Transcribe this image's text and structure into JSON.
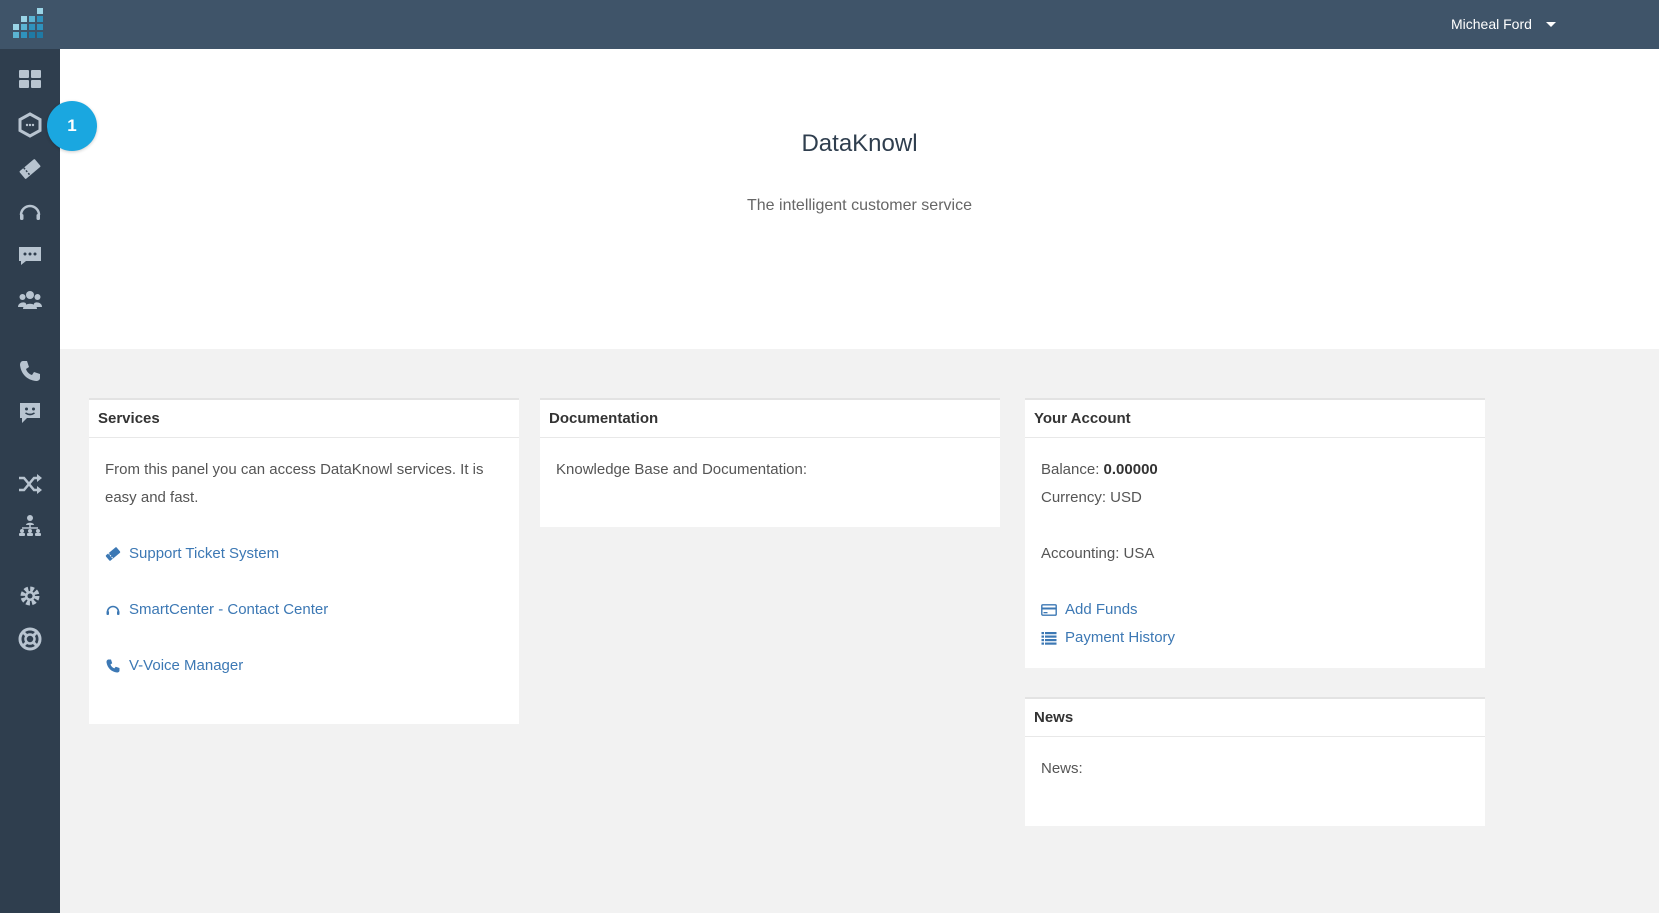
{
  "header": {
    "user_name": "Micheal Ford",
    "logo_icon": "grid-logo-icon"
  },
  "sidebar": {
    "items": [
      {
        "name": "dashboard",
        "icon": "dashboard-icon"
      },
      {
        "name": "services",
        "icon": "hexagon-icon"
      },
      {
        "name": "tickets",
        "icon": "ticket-icon"
      },
      {
        "name": "contact-center",
        "icon": "headset-icon"
      },
      {
        "name": "chat",
        "icon": "chat-icon"
      },
      {
        "name": "users",
        "icon": "users-icon"
      },
      {
        "name": "phone",
        "icon": "phone-icon"
      },
      {
        "name": "feedback",
        "icon": "feedback-icon"
      },
      {
        "name": "routing",
        "icon": "shuffle-icon"
      },
      {
        "name": "organization",
        "icon": "sitemap-icon"
      },
      {
        "name": "settings",
        "icon": "gear-icon"
      },
      {
        "name": "help",
        "icon": "lifebuoy-icon"
      }
    ],
    "badge": "1"
  },
  "hero": {
    "title": "DataKnowl",
    "subtitle": "The intelligent customer service"
  },
  "services": {
    "title": "Services",
    "description": "From this panel you can access DataKnowl services. It is easy and fast.",
    "links": [
      {
        "label": "Support Ticket System",
        "icon": "ticket-icon"
      },
      {
        "label": "SmartCenter - Contact Center",
        "icon": "headset-icon"
      },
      {
        "label": "V-Voice Manager",
        "icon": "phone-icon"
      }
    ]
  },
  "documentation": {
    "title": "Documentation",
    "text": "Knowledge Base and Documentation:"
  },
  "account": {
    "title": "Your Account",
    "balance_label": "Balance:",
    "balance_value": "0.00000",
    "currency": "Currency: USD",
    "accounting": "Accounting: USA",
    "add_funds": "Add Funds",
    "payment_history": "Payment History"
  },
  "news": {
    "title": "News",
    "text": "News:"
  },
  "colors": {
    "topbar": "#3f5469",
    "sidebar": "#2f3e4e",
    "accent": "#1aa7e0",
    "link": "#3c78b4"
  }
}
